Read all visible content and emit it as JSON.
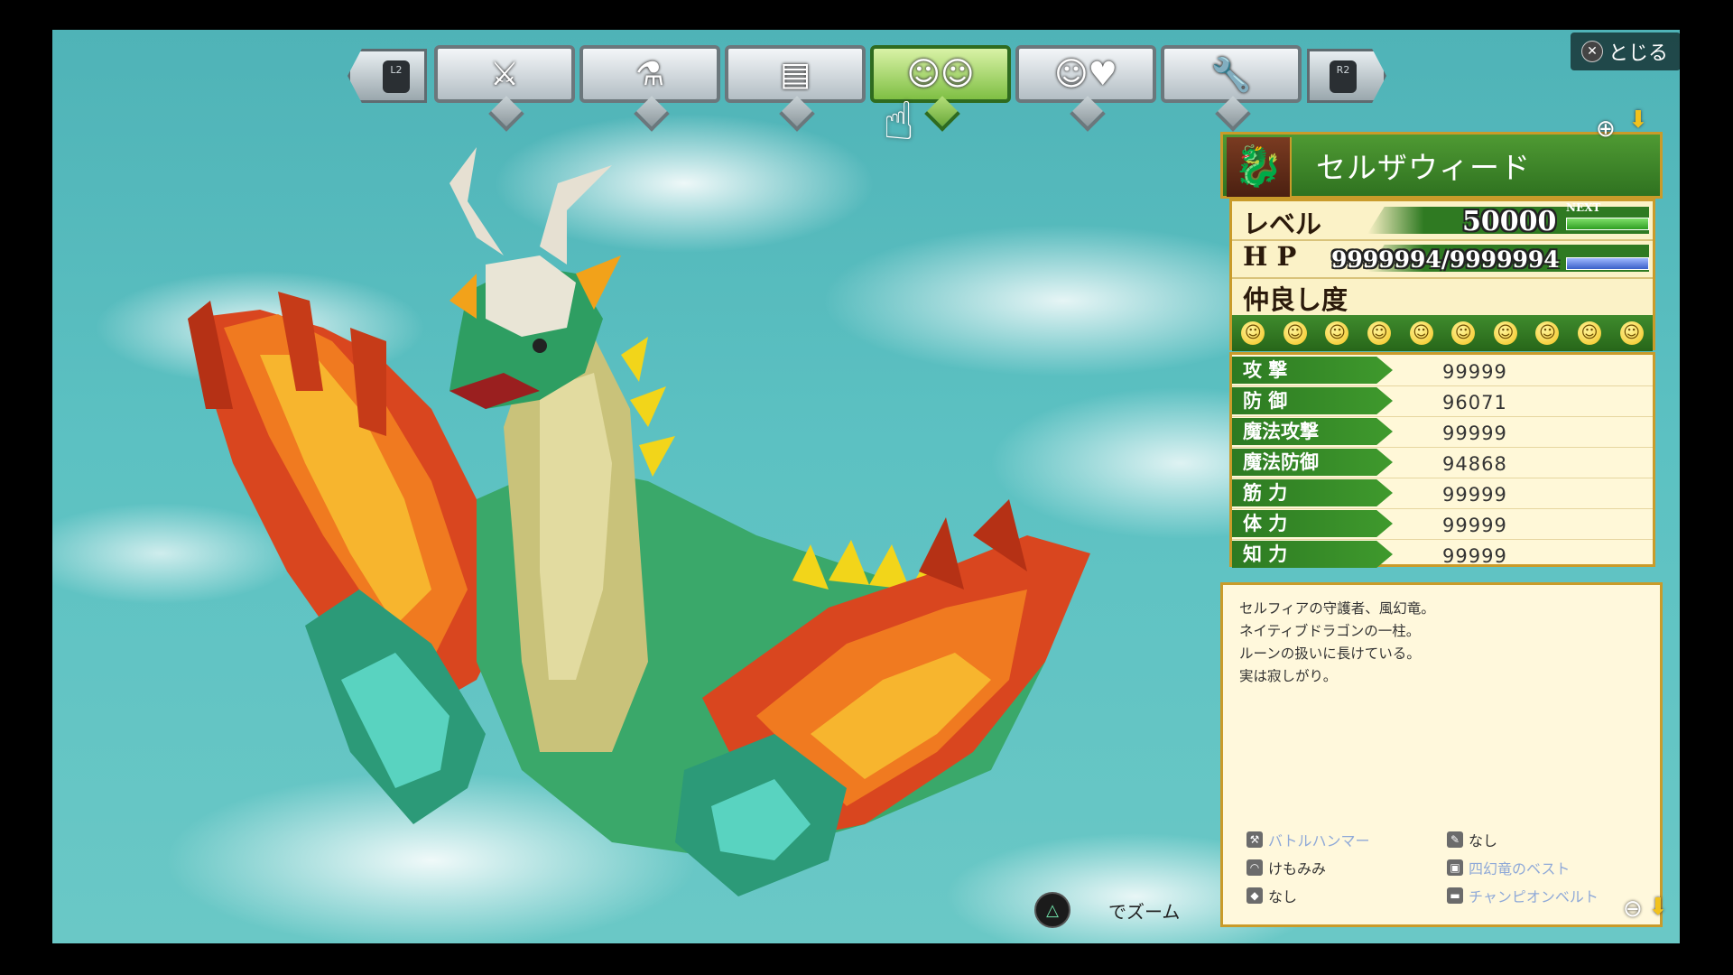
{
  "close": {
    "button_icon": "cross-button-icon",
    "label": "とじる"
  },
  "nav": {
    "left_trigger": "L2",
    "right_trigger": "R2",
    "tabs": [
      {
        "icon": "sword-shield-icon",
        "glyph": "⚔"
      },
      {
        "icon": "potion-hammer-icon",
        "glyph": "⚗"
      },
      {
        "icon": "document-icon",
        "glyph": "▤"
      },
      {
        "icon": "party-faces-icon",
        "glyph": "☺☺",
        "active": true
      },
      {
        "icon": "smile-heart-icon",
        "glyph": "☺♥"
      },
      {
        "icon": "wrench-icon",
        "glyph": "🔧"
      }
    ],
    "pointer_icon": "pointing-hand-icon"
  },
  "character": {
    "name": "セルザウィード",
    "level_label": "レベル",
    "level": "50000",
    "next_label": "NEXT",
    "hp_label": "H P",
    "hp": "9999994/9999994",
    "affinity_label": "仲良し度",
    "affinity_faces": 10
  },
  "stats": [
    {
      "label": "攻 撃",
      "value": "99999"
    },
    {
      "label": "防 御",
      "value": "96071"
    },
    {
      "label": "魔法攻撃",
      "value": "99999"
    },
    {
      "label": "魔法防御",
      "value": "94868"
    },
    {
      "label": "筋 力",
      "value": "99999"
    },
    {
      "label": "体 力",
      "value": "99999"
    },
    {
      "label": "知 力",
      "value": "99999"
    }
  ],
  "description": [
    "セルフィアの守護者、風幻竜。",
    "ネイティブドラゴンの一柱。",
    "ルーンの扱いに長けている。",
    "実は寂しがり。"
  ],
  "equipment": {
    "left": [
      {
        "icon": "weapon-icon",
        "label": "バトルハンマー",
        "dim": true
      },
      {
        "icon": "head-icon",
        "label": "けもみみ",
        "dim": false
      },
      {
        "icon": "shield-icon",
        "label": "なし",
        "dim": false
      }
    ],
    "right": [
      {
        "icon": "sub-weapon-icon",
        "label": "なし",
        "dim": false
      },
      {
        "icon": "armor-icon",
        "label": "四幻竜のベスト",
        "dim": true
      },
      {
        "icon": "accessory-icon",
        "label": "チャンピオンベルト",
        "dim": true
      }
    ]
  },
  "hint": {
    "button_icon": "triangle-button-icon",
    "text": "でズーム"
  },
  "colors": {
    "panel_border": "#c99b2a",
    "panel_green": "#2f7a22",
    "sky": "#5cc1c2"
  }
}
